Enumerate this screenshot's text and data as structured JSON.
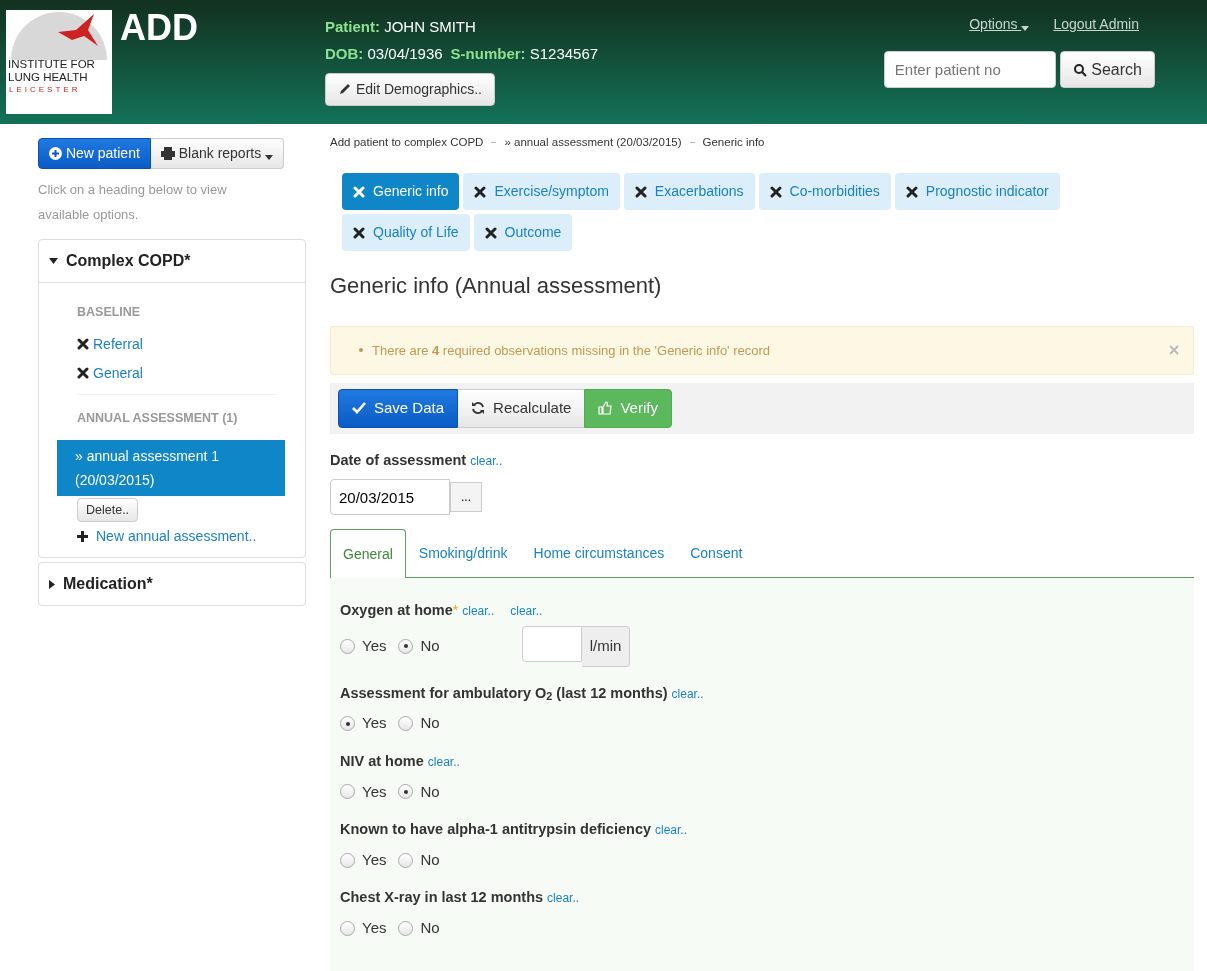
{
  "header": {
    "logo": {
      "lines": [
        "INSTITUTE FOR",
        "LUNG HEALTH"
      ],
      "city": "LEICESTER"
    },
    "app_title": "ADD",
    "patient_fields": [
      {
        "label": "Patient:",
        "value": "JOHN SMITH"
      },
      {
        "label": "DOB:",
        "value": "03/04/1936"
      },
      {
        "label": "S-number:",
        "value": "S1234567"
      }
    ],
    "edit_button": "Edit Demographics..",
    "nav": {
      "options": "Options",
      "logout": "Logout Admin"
    },
    "search": {
      "placeholder": "Enter patient no",
      "button": "Search"
    }
  },
  "sidebar": {
    "new_patient": "New patient",
    "blank_reports": "Blank reports",
    "hint": "Click on a heading below to view available options.",
    "panels": [
      {
        "title": "Complex COPD*",
        "expanded": true,
        "sections": [
          {
            "heading": "BASELINE",
            "items": [
              {
                "kind": "form",
                "label": "Referral",
                "selected": false
              },
              {
                "kind": "form",
                "label": "General",
                "selected": false
              }
            ]
          },
          {
            "heading": "ANNUAL ASSESSMENT (1)",
            "items": [
              {
                "kind": "entry",
                "label": "» annual assessment 1 (20/03/2015)",
                "selected": true
              }
            ],
            "delete_button": "Delete..",
            "add_link": "New annual assessment.."
          }
        ]
      },
      {
        "title": "Medication*",
        "expanded": false
      }
    ]
  },
  "breadcrumb": [
    "Add patient to complex COPD",
    "» annual assessment (20/03/2015)",
    "Generic info"
  ],
  "form_tabs": [
    {
      "label": "Generic info",
      "selected": true
    },
    {
      "label": "Exercise/symptom",
      "selected": false
    },
    {
      "label": "Exacerbations",
      "selected": false
    },
    {
      "label": "Co-morbidities",
      "selected": false
    },
    {
      "label": "Prognostic indicator",
      "selected": false
    },
    {
      "label": "Quality of Life",
      "selected": false
    },
    {
      "label": "Outcome",
      "selected": false
    }
  ],
  "heading": "Generic info (Annual assessment)",
  "alert": "There are **4** required observations missing in the 'Generic info' record",
  "toolbar": [
    {
      "kind": "save",
      "label": "Save Data"
    },
    {
      "kind": "recalc",
      "label": "Recalculate"
    },
    {
      "kind": "verify",
      "label": "Verify"
    }
  ],
  "date_field": {
    "label": "Date of assessment",
    "clear": "clear..",
    "value": "20/03/2015",
    "picker": "..."
  },
  "sub_tabs": [
    {
      "label": "General",
      "selected": true
    },
    {
      "label": "Smoking/drink",
      "selected": false
    },
    {
      "label": "Home circumstances",
      "selected": false
    },
    {
      "label": "Consent",
      "selected": false
    }
  ],
  "questions": [
    {
      "label": "Oxygen at home",
      "required_mark": "*",
      "clear_links": [
        "clear..",
        "clear.."
      ],
      "options": [
        {
          "label": "Yes",
          "selected": false
        },
        {
          "label": "No",
          "selected": true
        }
      ],
      "unit": "l/min"
    },
    {
      "label": "Assessment for ambulatory O$_{2}$ (last 12 months)",
      "clear_links": [
        "clear.."
      ],
      "options": [
        {
          "label": "Yes",
          "selected": true
        },
        {
          "label": "No",
          "selected": false
        }
      ]
    },
    {
      "label": "NIV at home",
      "clear_links": [
        "clear.."
      ],
      "options": [
        {
          "label": "Yes",
          "selected": false
        },
        {
          "label": "No",
          "selected": true
        }
      ]
    },
    {
      "label": "Known to have alpha-1 antitrypsin deficiency",
      "clear_links": [
        "clear.."
      ],
      "options": [
        {
          "label": "Yes",
          "selected": false
        },
        {
          "label": "No",
          "selected": false
        }
      ]
    },
    {
      "label": "Chest X-ray in last 12 months",
      "clear_links": [
        "clear.."
      ],
      "options": [
        {
          "label": "Yes",
          "selected": false
        },
        {
          "label": "No",
          "selected": false
        }
      ]
    }
  ]
}
